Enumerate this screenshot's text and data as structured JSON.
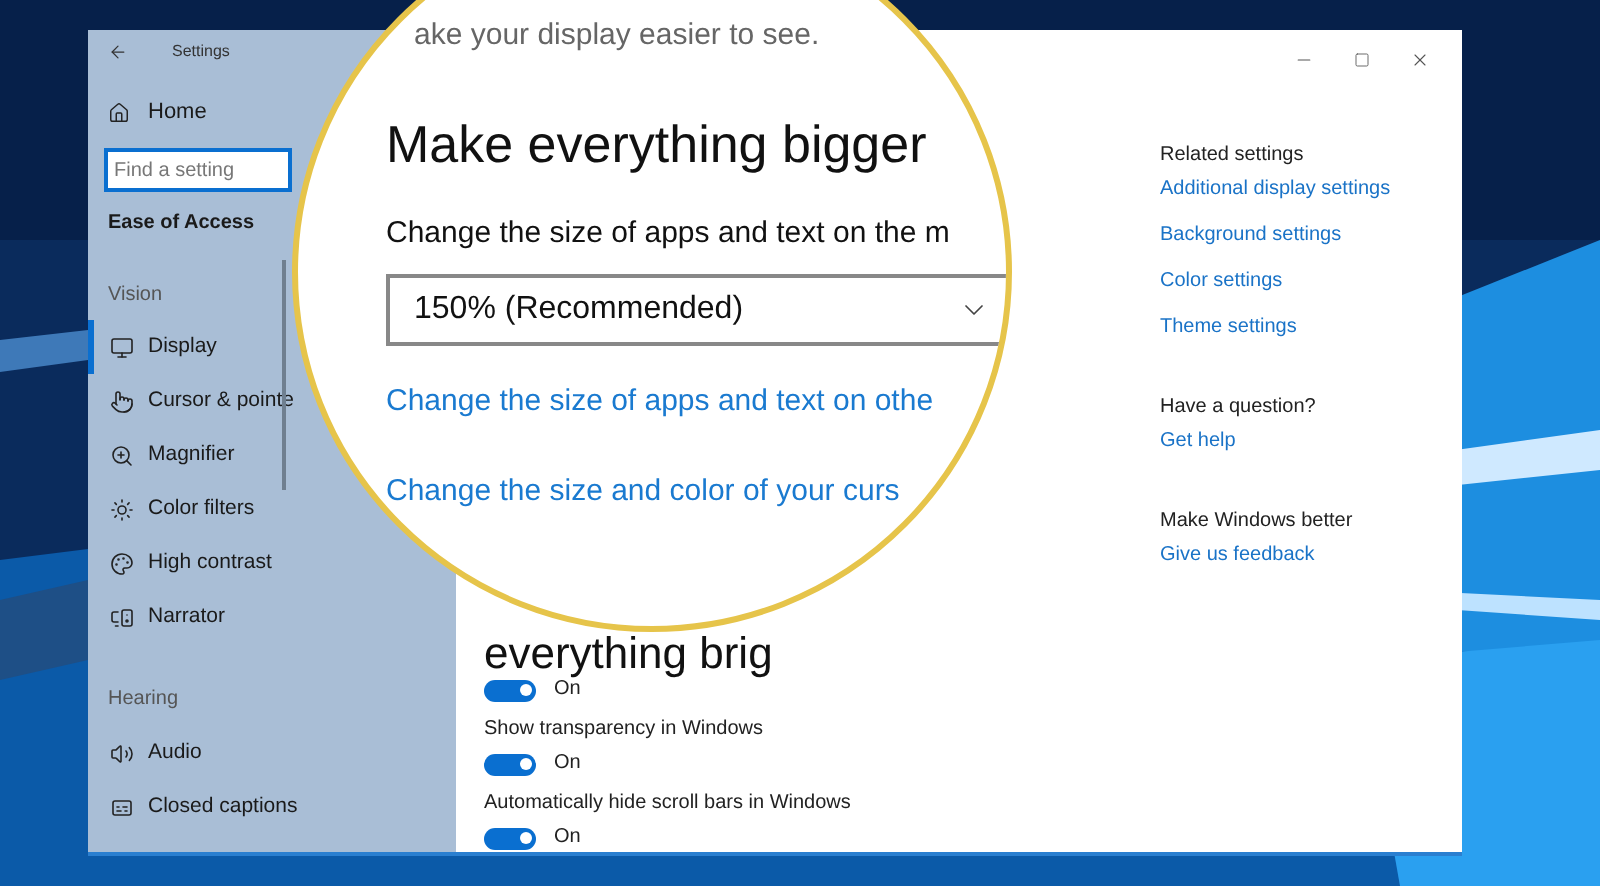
{
  "window": {
    "title": "Settings"
  },
  "sidebar": {
    "home": "Home",
    "search": {
      "placeholder": "Find a setting"
    },
    "category": "Ease of Access",
    "groups": [
      {
        "heading": "Vision",
        "items": [
          {
            "label": "Display",
            "selected": true
          },
          {
            "label": "Cursor & pointe",
            "selected": false
          },
          {
            "label": "Magnifier",
            "selected": false
          },
          {
            "label": "Color filters",
            "selected": false
          },
          {
            "label": "High contrast",
            "selected": false
          },
          {
            "label": "Narrator",
            "selected": false
          }
        ]
      },
      {
        "heading": "Hearing",
        "items": [
          {
            "label": "Audio",
            "selected": false
          },
          {
            "label": "Closed captions",
            "selected": false
          }
        ]
      }
    ]
  },
  "magnifier": {
    "subtitle": "ake your display easier to see.",
    "heading": "Make everything bigger",
    "label": "Change the size of apps and text on the m",
    "dropdown": {
      "value": "150% (Recommended)"
    },
    "links": [
      "Change the size of apps and text on othe",
      "Change the size and color of your curs"
    ]
  },
  "content": {
    "heading": "everything brig",
    "toggles": [
      {
        "on": true,
        "state_text": "On"
      },
      {
        "label": "Show transparency in Windows",
        "on": true,
        "state_text": "On"
      },
      {
        "label": "Automatically hide scroll bars in Windows",
        "on": true,
        "state_text": "On"
      }
    ]
  },
  "related": [
    {
      "heading": "Related settings",
      "links": [
        "Additional display settings",
        "Background settings",
        "Color settings",
        "Theme settings"
      ]
    },
    {
      "heading": "Have a question?",
      "links": [
        "Get help"
      ]
    },
    {
      "heading": "Make Windows better",
      "links": [
        "Give us feedback"
      ]
    }
  ]
}
